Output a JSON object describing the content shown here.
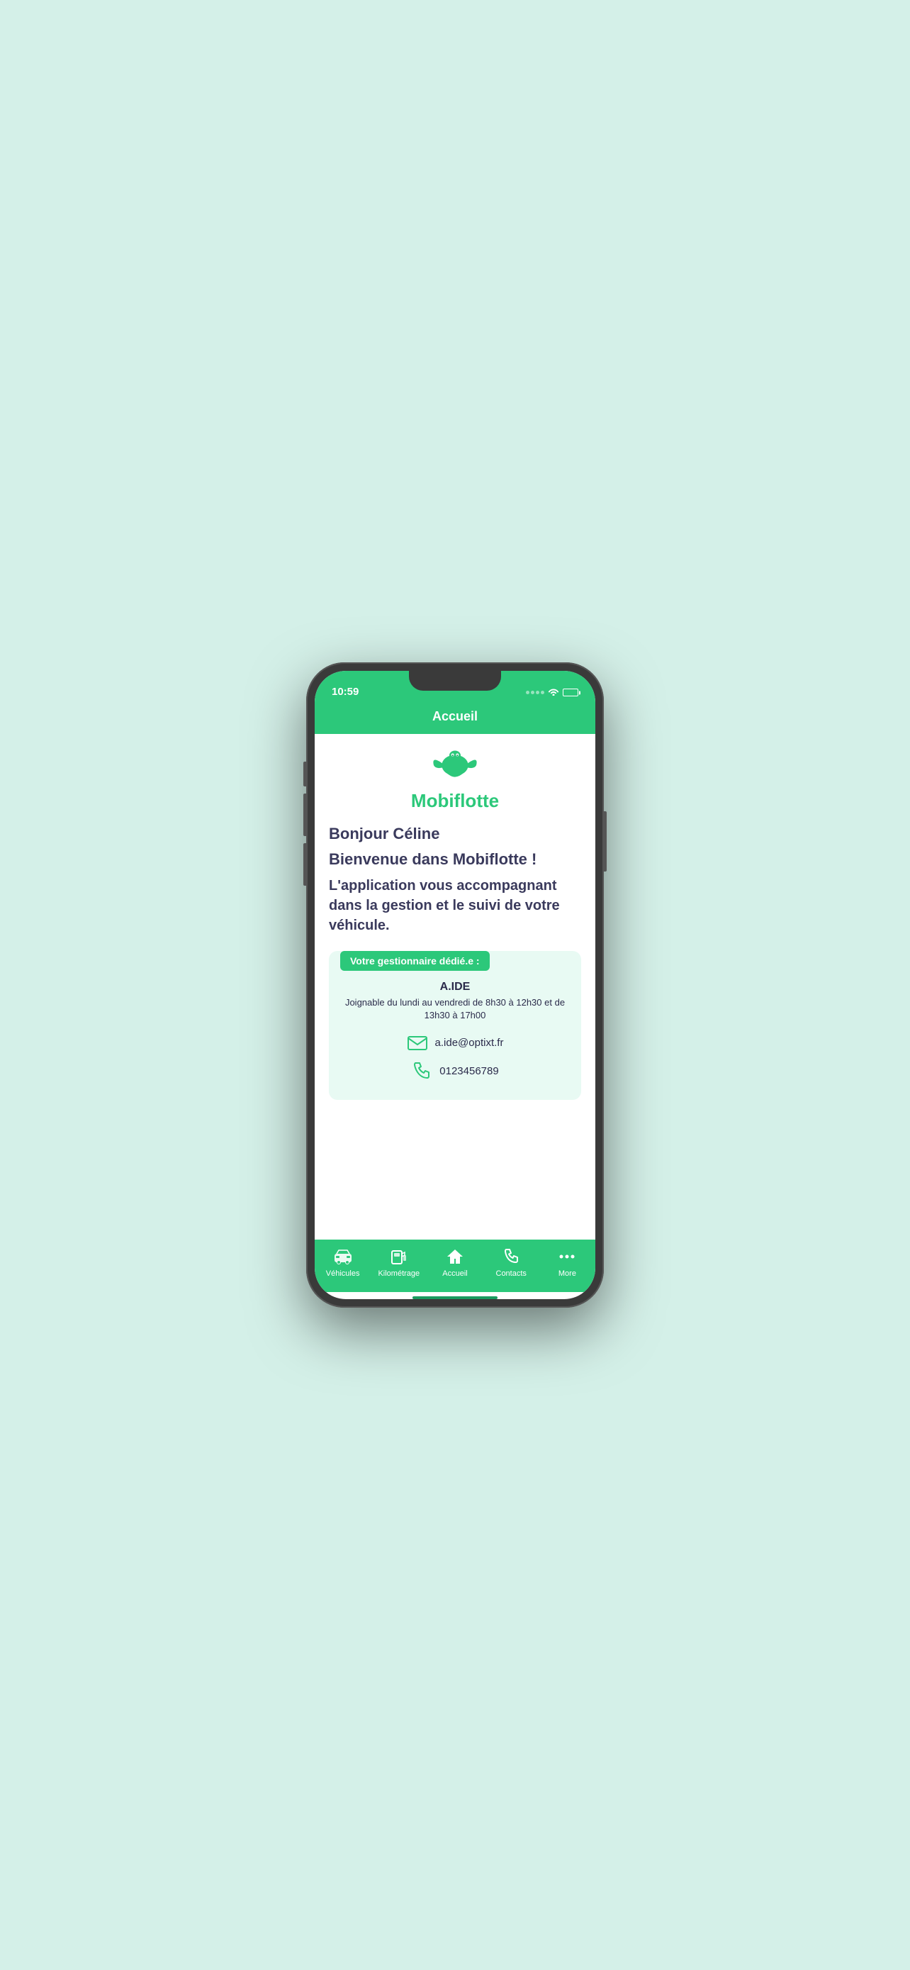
{
  "statusBar": {
    "time": "10:59"
  },
  "header": {
    "title": "Accueil"
  },
  "logo": {
    "text": "Mobiflotte"
  },
  "content": {
    "greeting": "Bonjour Céline",
    "welcome": "Bienvenue dans Mobiflotte !",
    "description": "L'application vous accompagnant dans la gestion et le suivi de votre véhicule.",
    "managerLabel": "Votre gestionnaire dédié.e :",
    "managerName": "A.IDE",
    "managerHours": "Joignable du lundi au vendredi de 8h30 à 12h30 et de 13h30 à 17h00",
    "managerEmail": "a.ide@optixt.fr",
    "managerPhone": "0123456789"
  },
  "bottomNav": {
    "items": [
      {
        "label": "Véhicules",
        "icon": "car"
      },
      {
        "label": "Kilométrage",
        "icon": "fuel"
      },
      {
        "label": "Accueil",
        "icon": "home",
        "active": true
      },
      {
        "label": "Contacts",
        "icon": "phone"
      },
      {
        "label": "More",
        "icon": "more"
      }
    ]
  },
  "colors": {
    "primary": "#2cc87a",
    "dark": "#3a3a5c",
    "cardBg": "#e8faf3"
  }
}
